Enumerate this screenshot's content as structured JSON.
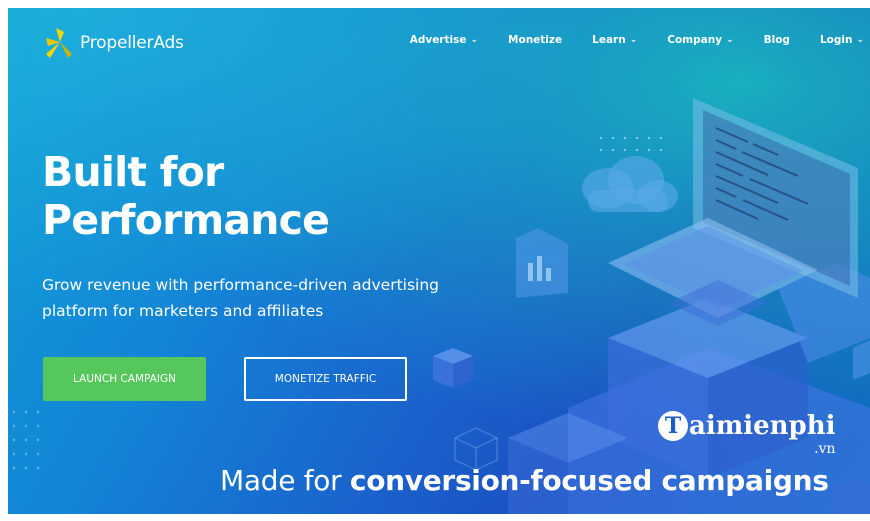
{
  "brand": {
    "name": "PropellerAds",
    "logo_icon": "propeller-logo-icon"
  },
  "nav": {
    "items": [
      {
        "label": "Advertise",
        "dropdown": true
      },
      {
        "label": "Monetize",
        "dropdown": false
      },
      {
        "label": "Learn",
        "dropdown": true
      },
      {
        "label": "Company",
        "dropdown": true
      },
      {
        "label": "Blog",
        "dropdown": false
      },
      {
        "label": "Login",
        "dropdown": true
      }
    ],
    "chevron_glyph": "⌄"
  },
  "hero": {
    "title_line1": "Built for",
    "title_line2": "Performance",
    "subtitle": "Grow revenue with performance-driven advertising platform for marketers and affiliates",
    "primary_button": "LAUNCH CAMPAIGN",
    "secondary_button": "MONETIZE TRAFFIC"
  },
  "tagline": {
    "prefix": "Made for",
    "emphasis": "conversion-focused campaigns"
  },
  "watermark": {
    "initial": "T",
    "text": "aimienphi",
    "suffix": ".vn"
  },
  "colors": {
    "hero_blue": "#1a63cc",
    "hero_teal": "#18cdbe",
    "launch_green": "#56c75c",
    "logo_yellow": "#f5d800",
    "text_white": "#ffffff"
  }
}
